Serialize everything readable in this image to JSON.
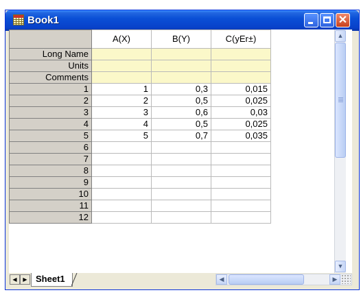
{
  "window": {
    "title": "Book1"
  },
  "columns": [
    "A(X)",
    "B(Y)",
    "C(yEr±)"
  ],
  "meta_rows": [
    "Long Name",
    "Units",
    "Comments"
  ],
  "rows": [
    {
      "label": "1",
      "cells": [
        "1",
        "0,3",
        "0,015"
      ]
    },
    {
      "label": "2",
      "cells": [
        "2",
        "0,5",
        "0,025"
      ]
    },
    {
      "label": "3",
      "cells": [
        "3",
        "0,6",
        "0,03"
      ]
    },
    {
      "label": "4",
      "cells": [
        "4",
        "0,5",
        "0,025"
      ]
    },
    {
      "label": "5",
      "cells": [
        "5",
        "0,7",
        "0,035"
      ]
    },
    {
      "label": "6",
      "cells": [
        "",
        "",
        ""
      ]
    },
    {
      "label": "7",
      "cells": [
        "",
        "",
        ""
      ]
    },
    {
      "label": "8",
      "cells": [
        "",
        "",
        ""
      ]
    },
    {
      "label": "9",
      "cells": [
        "",
        "",
        ""
      ]
    },
    {
      "label": "10",
      "cells": [
        "",
        "",
        ""
      ]
    },
    {
      "label": "11",
      "cells": [
        "",
        "",
        ""
      ]
    },
    {
      "label": "12",
      "cells": [
        "",
        "",
        ""
      ]
    }
  ],
  "tabs": {
    "active": "Sheet1"
  },
  "colors": {
    "titlebar": "#0841c9",
    "meta_fill": "#fbf8c9",
    "header_fill": "#d4d0c8"
  }
}
